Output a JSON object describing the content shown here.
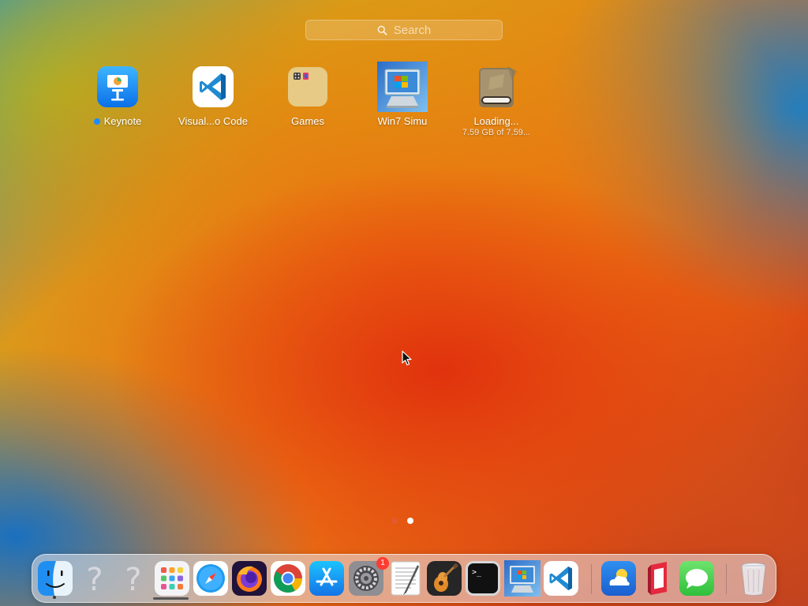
{
  "search": {
    "placeholder": "Search",
    "icon": "magnifier-icon"
  },
  "apps": [
    {
      "label": "Keynote",
      "icon": "keynote-icon",
      "new_indicator": true,
      "indicator_color": "#1d8cff"
    },
    {
      "label": "Visual...o Code",
      "icon": "vscode-icon"
    },
    {
      "label": "Games",
      "icon": "games-folder-icon"
    },
    {
      "label": "Win7 Simu",
      "icon": "win7-simu-icon"
    },
    {
      "label": "Loading...",
      "sub": "7.59 GB of 7.59...",
      "icon": "installer-icon",
      "progress": 1.0
    }
  ],
  "page_indicator": {
    "pages": 2,
    "current": 2,
    "active_color": "#ffffff",
    "inactive_color": "#e35a2e"
  },
  "dock": {
    "items": [
      {
        "name": "finder-icon",
        "running": true
      },
      {
        "name": "unknown-app-icon"
      },
      {
        "name": "unknown-app-icon"
      },
      {
        "name": "launchpad-icon",
        "active": true
      },
      {
        "name": "safari-icon"
      },
      {
        "name": "firefox-icon"
      },
      {
        "name": "chrome-icon"
      },
      {
        "name": "app-store-icon"
      },
      {
        "name": "system-settings-icon",
        "badge": "1"
      },
      {
        "name": "textedit-icon"
      },
      {
        "name": "garageband-icon"
      },
      {
        "name": "terminal-icon"
      },
      {
        "name": "win7-simu-icon"
      },
      {
        "name": "vscode-icon"
      },
      {
        "name": "weather-icon"
      },
      {
        "name": "parallels-icon"
      },
      {
        "name": "messages-icon"
      },
      {
        "name": "trash-icon"
      }
    ]
  },
  "colors": {
    "accent": "#1d8cff",
    "badge": "#ff3b30"
  }
}
